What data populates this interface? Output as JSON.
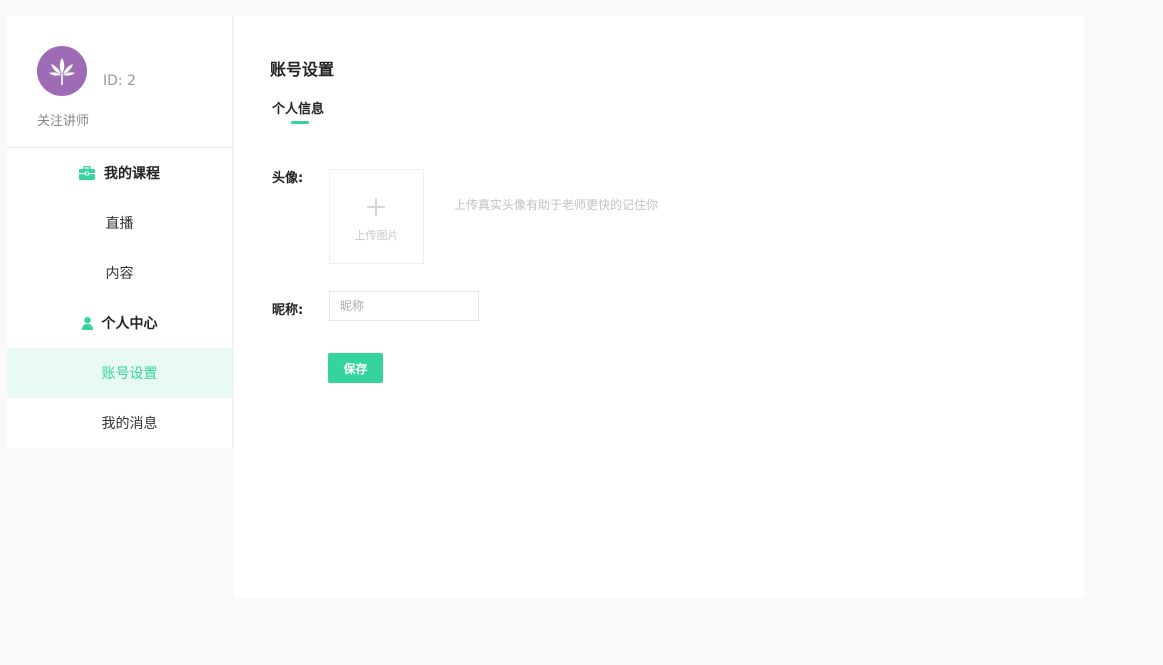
{
  "sidebar": {
    "profile": {
      "id_text": "ID: 2",
      "follow_label": "关注讲师"
    },
    "groups": [
      {
        "label": "我的课程",
        "icon": "briefcase-icon",
        "items": [
          {
            "label": "直播"
          },
          {
            "label": "内容"
          }
        ]
      },
      {
        "label": "个人中心",
        "icon": "user-icon",
        "items": [
          {
            "label": "账号设置",
            "active": true
          },
          {
            "label": "我的消息"
          }
        ]
      }
    ]
  },
  "main": {
    "title": "账号设置",
    "tabs": [
      {
        "label": "个人信息",
        "active": true
      }
    ],
    "form": {
      "avatar_label": "头像:",
      "upload_label": "上传图片",
      "upload_hint": "上传真实头像有助于老师更快的记住你",
      "nickname_label": "昵称:",
      "nickname_placeholder": "昵称",
      "nickname_value": "",
      "save_label": "保存"
    }
  },
  "colors": {
    "accent": "#35d49e",
    "accent_light": "#e8faf3",
    "avatar_bg": "#9e6bb5",
    "page_bg": "#f9f9f9"
  }
}
